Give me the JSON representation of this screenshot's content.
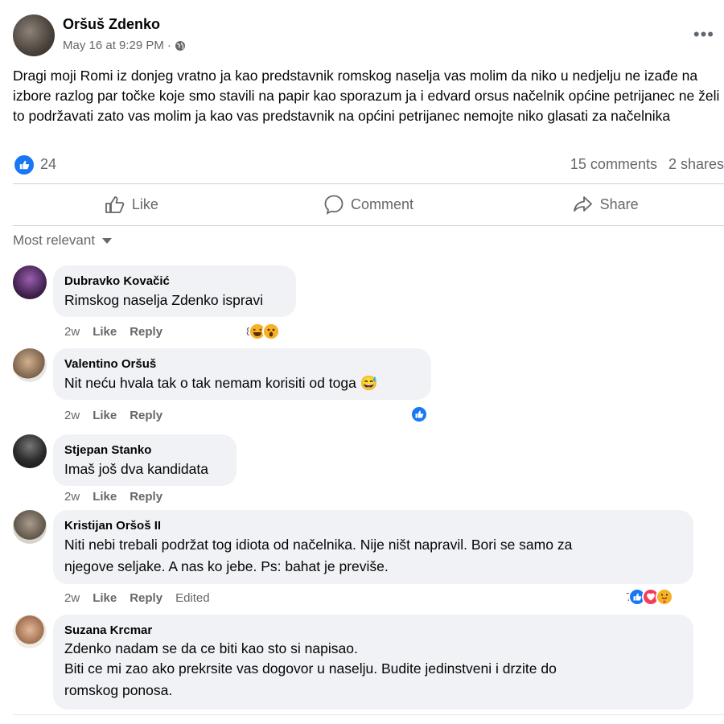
{
  "post": {
    "author": "Oršuš Zdenko",
    "date": "May 16 at 9:29 PM",
    "separator": "·",
    "privacy_icon": "globe-icon",
    "more_label": "•••",
    "text": "Dragi moji Romi iz donjeg vratno ja kao predstavnik romskog naselja vas molim da niko u nedjelju ne izađe na izbore razlog par točke koje smo stavili na papir kao sporazum ja i edvard orsus načelnik općine petrijanec ne želi to podržavati zato vas molim ja kao vas predstavnik na općini petrijanec nemojte niko glasati za načelnika",
    "like_count": "24",
    "comments_count": "15 comments",
    "shares_count": "2 shares"
  },
  "actions": {
    "like": "Like",
    "comment": "Comment",
    "share": "Share"
  },
  "sort_label": "Most relevant",
  "comments": [
    {
      "name": "Dubravko Kovačić",
      "text": "Rimskog naselja Zdenko ispravi",
      "time": "2w",
      "like": "Like",
      "reply": "Reply",
      "reaction_count": "8",
      "reactions": [
        "haha",
        "wow"
      ]
    },
    {
      "name": "Valentino Oršuš",
      "text": "Nit neću hvala tak o tak nemam korisiti od toga 😅",
      "time": "2w",
      "like": "Like",
      "reply": "Reply",
      "reaction_count": "",
      "reactions": [
        "like"
      ]
    },
    {
      "name": "Stjepan Stanko",
      "text": "Imaš još dva kandidata",
      "time": "2w",
      "like": "Like",
      "reply": "Reply"
    },
    {
      "name": "Kristijan Oršoš II",
      "line1": "Niti nebi trebali podržat tog idiota od načelnika. Nije ništ napravil. Bori se samo za",
      "line2": "njegove seljake. A nas ko jebe. Ps: bahat je previše.",
      "time": "2w",
      "like": "Like",
      "reply": "Reply",
      "edited": "Edited",
      "reaction_count": "7",
      "reactions": [
        "like",
        "love",
        "care"
      ]
    },
    {
      "name": "Suzana Krcmar",
      "line1": "Zdenko nadam se da ce biti kao sto si napisao.",
      "line2": "Biti ce mi zao ako prekrsite vas dogovor u naselju. Budite jedinstveni i drzite do",
      "line3": "romskog ponosa."
    }
  ],
  "colors": {
    "facebook_blue": "#1877f2",
    "secondary_text": "#65676b",
    "bubble_bg": "#f0f2f5",
    "love_red": "#f33e58",
    "emoji_yellow": "#f7b125"
  }
}
